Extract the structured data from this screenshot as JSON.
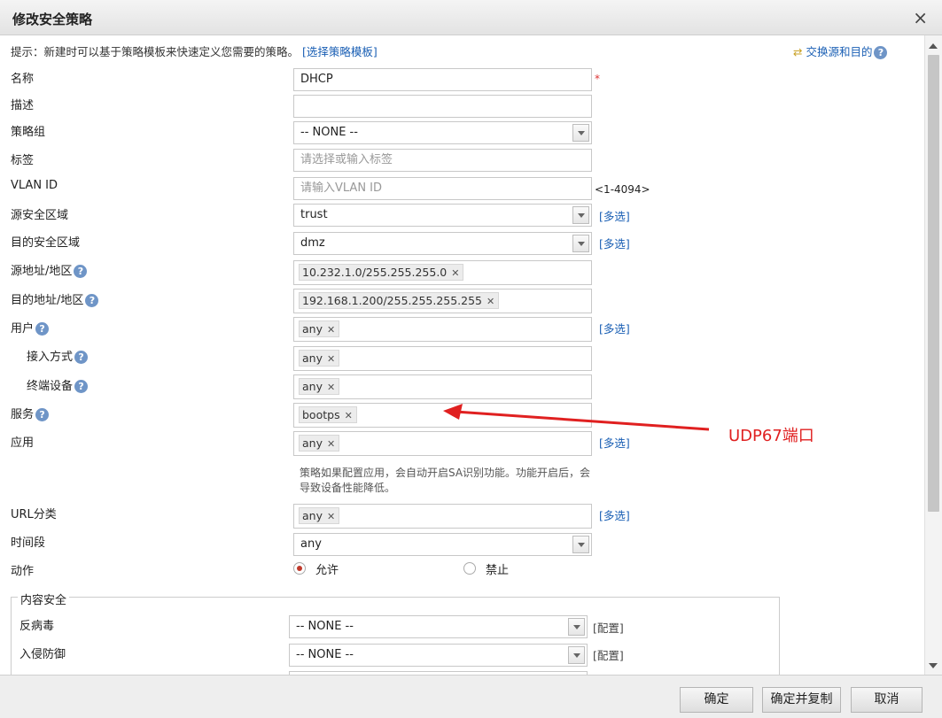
{
  "dialog": {
    "title": "修改安全策略",
    "close": "×"
  },
  "hint": {
    "text": "提示：新建时可以基于策略模板来快速定义您需要的策略。",
    "link": "[选择策略模板]"
  },
  "swap": {
    "label": "交换源和目的"
  },
  "help": "?",
  "fields": {
    "name": {
      "label": "名称",
      "value": "DHCP",
      "required": "*"
    },
    "desc": {
      "label": "描述",
      "value": ""
    },
    "group": {
      "label": "策略组",
      "value": "-- NONE --"
    },
    "tag": {
      "label": "标签",
      "placeholder": "请选择或输入标签"
    },
    "vlan": {
      "label": "VLAN ID",
      "placeholder": "请输入VLAN ID",
      "range": "<1-4094>"
    },
    "src_zone": {
      "label": "源安全区域",
      "value": "trust",
      "multi": "[多选]"
    },
    "dst_zone": {
      "label": "目的安全区域",
      "value": "dmz",
      "multi": "[多选]"
    },
    "src_addr": {
      "label": "源地址/地区",
      "chip": "10.232.1.0/255.255.255.0"
    },
    "dst_addr": {
      "label": "目的地址/地区",
      "chip": "192.168.1.200/255.255.255.255"
    },
    "user": {
      "label": "用户",
      "chip": "any",
      "multi": "[多选]"
    },
    "access": {
      "label": "接入方式",
      "chip": "any"
    },
    "device": {
      "label": "终端设备",
      "chip": "any"
    },
    "service": {
      "label": "服务",
      "chip": "bootps"
    },
    "app": {
      "label": "应用",
      "chip": "any",
      "multi": "[多选]",
      "note": "策略如果配置应用，会自动开启SA识别功能。功能开启后，会导致设备性能降低。"
    },
    "url": {
      "label": "URL分类",
      "chip": "any",
      "multi": "[多选]"
    },
    "time": {
      "label": "时间段",
      "value": "any"
    },
    "action": {
      "label": "动作",
      "allow": "允许",
      "deny": "禁止",
      "selected": "allow"
    }
  },
  "content_security": {
    "legend": "内容安全",
    "antivirus": {
      "label": "反病毒",
      "value": "-- NONE --",
      "cfg": "[配置]"
    },
    "ips": {
      "label": "入侵防御",
      "value": "-- NONE --",
      "cfg": "[配置]"
    }
  },
  "annotation": {
    "text": "UDP67端口",
    "color": "#e02020"
  },
  "buttons": {
    "ok": "确定",
    "ok_copy": "确定并复制",
    "cancel": "取消"
  }
}
